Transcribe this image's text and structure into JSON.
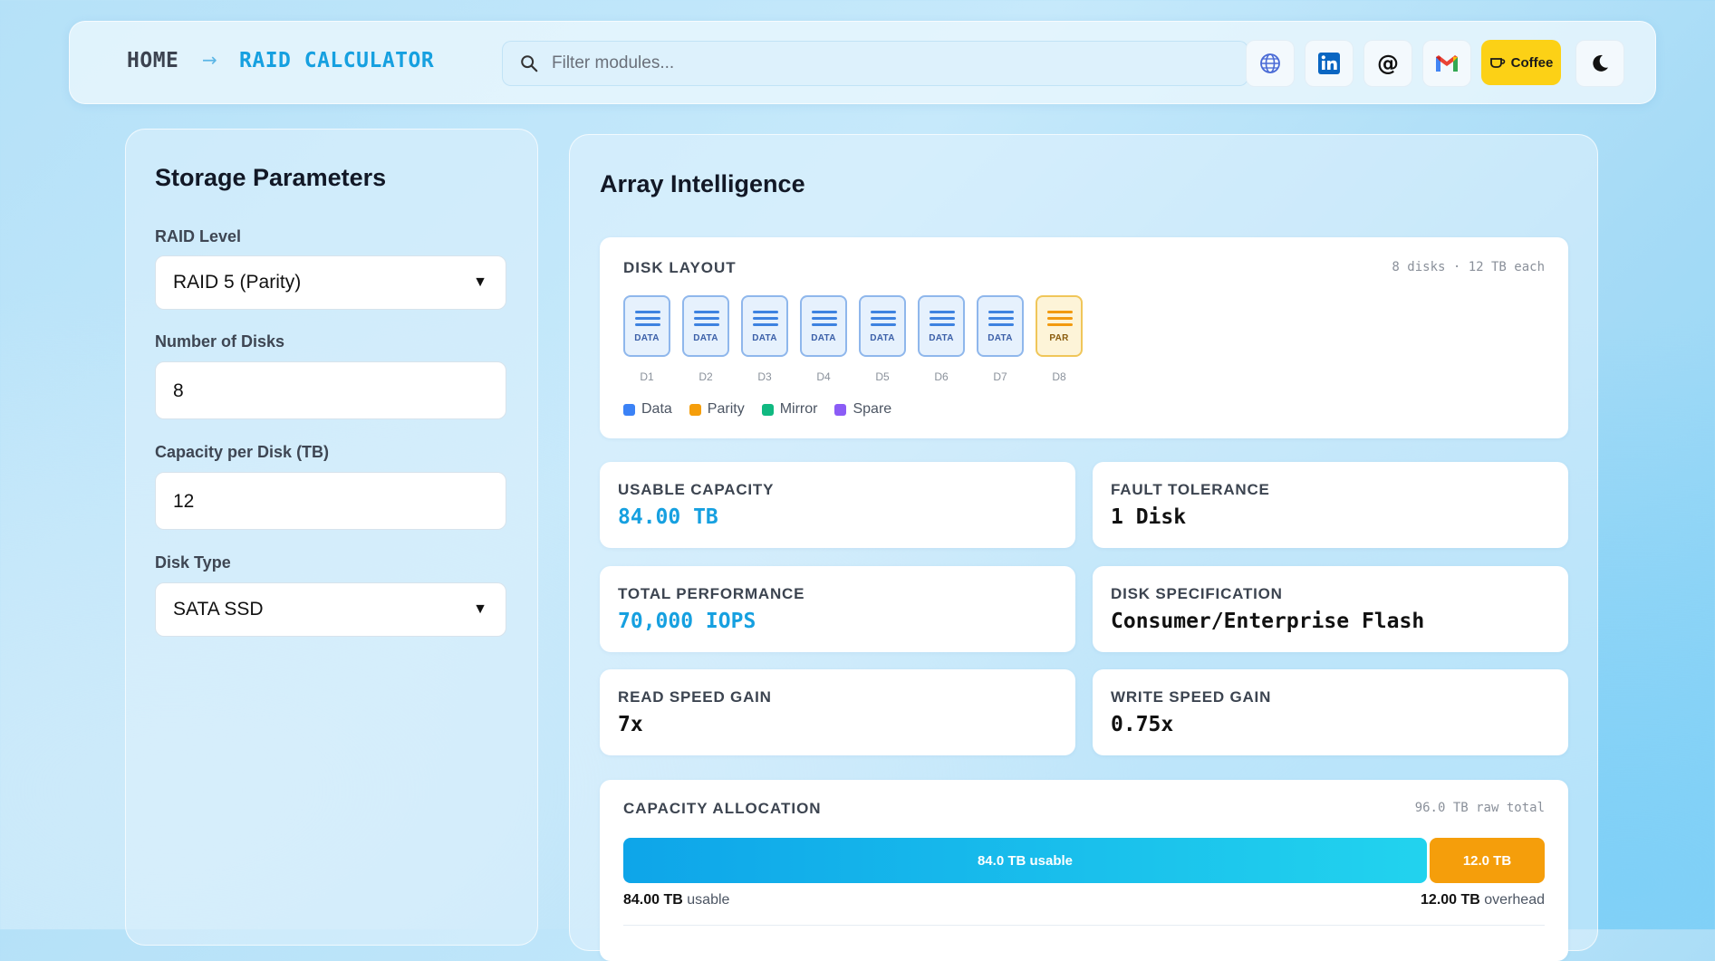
{
  "header": {
    "breadcrumb_home": "HOME",
    "breadcrumb_arrow": "→",
    "breadcrumb_current": "RAID CALCULATOR",
    "search_placeholder": "Filter modules...",
    "coffee_label": "Coffee",
    "icons": [
      "globe-icon",
      "linkedin-icon",
      "at-icon",
      "gmail-icon",
      "coffee-icon",
      "moon-icon"
    ]
  },
  "params": {
    "title": "Storage Parameters",
    "raid_label": "RAID Level",
    "raid_value": "RAID 5 (Parity)",
    "disks_label": "Number of Disks",
    "disks_value": "8",
    "capacity_label": "Capacity per Disk (TB)",
    "capacity_value": "12",
    "type_label": "Disk Type",
    "type_value": "SATA SSD"
  },
  "array": {
    "title": "Array Intelligence",
    "layout_title": "DISK LAYOUT",
    "layout_meta": "8 disks · 12 TB each",
    "disks": [
      {
        "label": "DATA",
        "name": "D1",
        "kind": "data"
      },
      {
        "label": "DATA",
        "name": "D2",
        "kind": "data"
      },
      {
        "label": "DATA",
        "name": "D3",
        "kind": "data"
      },
      {
        "label": "DATA",
        "name": "D4",
        "kind": "data"
      },
      {
        "label": "DATA",
        "name": "D5",
        "kind": "data"
      },
      {
        "label": "DATA",
        "name": "D6",
        "kind": "data"
      },
      {
        "label": "DATA",
        "name": "D7",
        "kind": "data"
      },
      {
        "label": "PAR",
        "name": "D8",
        "kind": "par"
      }
    ],
    "legend": [
      {
        "label": "Data",
        "color": "#3b82f6"
      },
      {
        "label": "Parity",
        "color": "#f59e0b"
      },
      {
        "label": "Mirror",
        "color": "#10b981"
      },
      {
        "label": "Spare",
        "color": "#8b5cf6"
      }
    ],
    "stats": {
      "usable_label": "USABLE CAPACITY",
      "usable_value": "84.00 TB",
      "fault_label": "FAULT TOLERANCE",
      "fault_value": "1 Disk",
      "perf_label": "TOTAL PERFORMANCE",
      "perf_value": "70,000 IOPS",
      "spec_label": "DISK SPECIFICATION",
      "spec_value": "Consumer/Enterprise Flash",
      "read_label": "READ SPEED GAIN",
      "read_value": "7x",
      "write_label": "WRITE SPEED GAIN",
      "write_value": "0.75x"
    },
    "allocation": {
      "title": "CAPACITY ALLOCATION",
      "meta": "96.0 TB raw total",
      "usable_bar": "84.0 TB usable",
      "overhead_bar": "12.0 TB",
      "usable_fraction": 0.875,
      "usable_amount": "84.00 TB",
      "usable_word": "usable",
      "overhead_amount": "12.00 TB",
      "overhead_word": "overhead"
    }
  },
  "colors": {
    "accent": "#16a0e0",
    "coffee_bg": "#fcd116",
    "overhead": "#f59e0b"
  }
}
